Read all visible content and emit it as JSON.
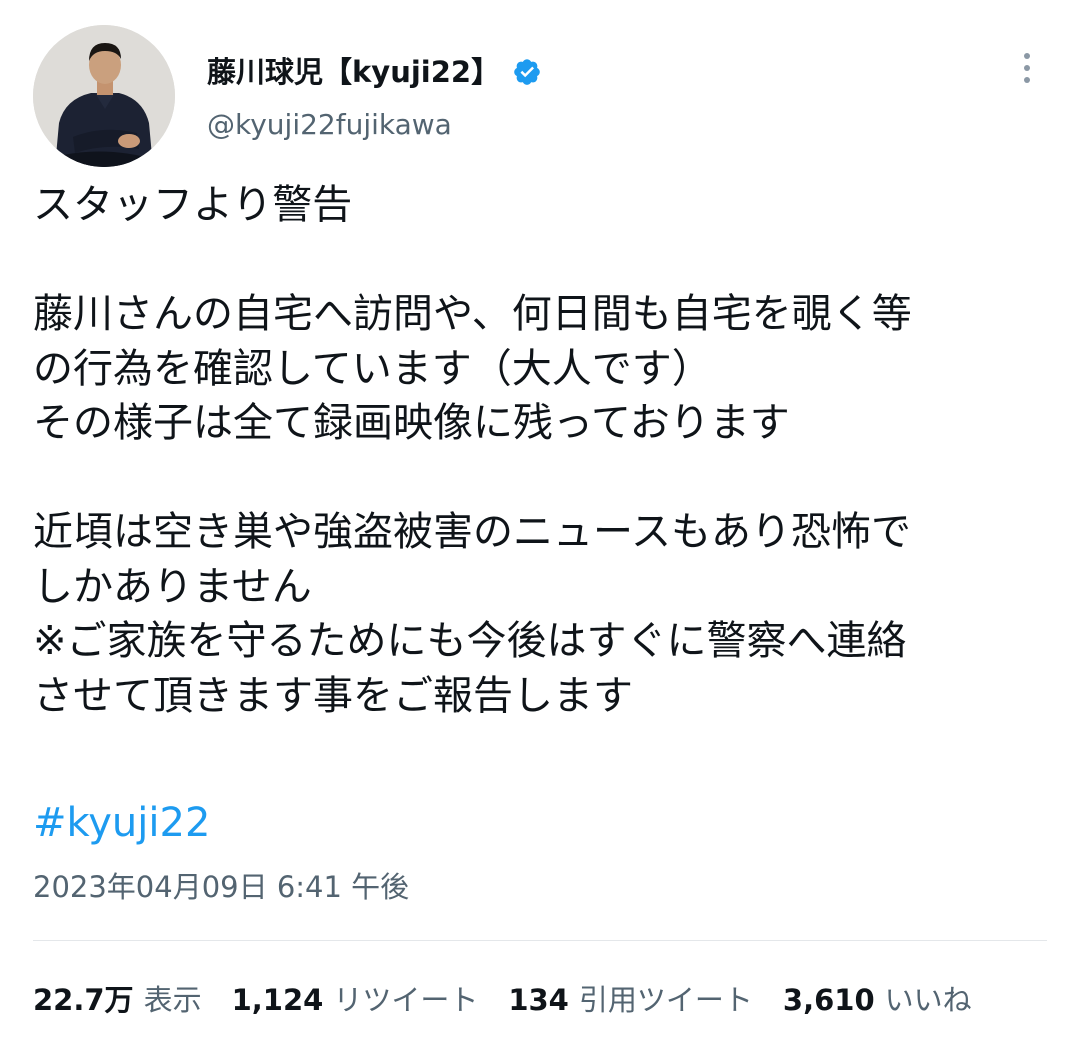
{
  "header": {
    "display_name": "藤川球児【kyuji22】",
    "handle": "@kyuji22fujikawa",
    "verified_icon": "verified-badge-icon",
    "more_icon": "more-vertical-icon"
  },
  "tweet": {
    "text": "スタッフより警告\n\n藤川さんの自宅へ訪問や、何日間も自宅を覗く等\nの行為を確認しています（大人です）\nその様子は全て録画映像に残っております\n\n近頃は空き巣や強盗被害のニュースもあり恐怖で\nしかありません\n※ご家族を守るためにも今後はすぐに警察へ連絡\nさせて頂きます事をご報告します",
    "hashtag": "#kyuji22",
    "timestamp": "2023年04月09日 6:41 午後"
  },
  "stats": {
    "views": {
      "num": "22.7万",
      "label": "表示"
    },
    "retweets": {
      "num": "1,124",
      "label": "リツイート"
    },
    "quotes": {
      "num": "134",
      "label": "引用ツイート"
    },
    "likes": {
      "num": "3,610",
      "label": "いいね"
    }
  },
  "colors": {
    "text": "#0f1419",
    "secondary": "#536471",
    "link": "#1d9bf0",
    "verified": "#1d9bf0"
  }
}
